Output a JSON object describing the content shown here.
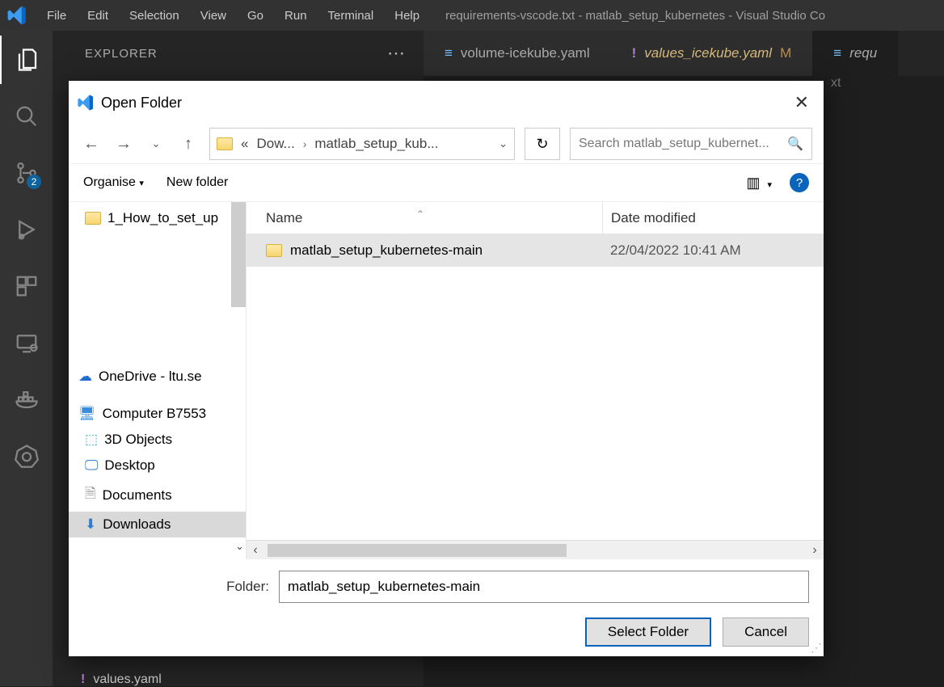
{
  "menubar": {
    "items": [
      "File",
      "Edit",
      "Selection",
      "View",
      "Go",
      "Run",
      "Terminal",
      "Help"
    ],
    "title": "requirements-vscode.txt - matlab_setup_kubernetes - Visual Studio Co"
  },
  "sidebar": {
    "header": "EXPLORER"
  },
  "activity": {
    "badge": "2"
  },
  "tabs": [
    {
      "icon": "lines",
      "label": "volume-icekube.yaml",
      "modified": false
    },
    {
      "icon": "exclaim",
      "label": "values_icekube.yaml",
      "modified": true,
      "modLabel": "M",
      "yellow": true
    },
    {
      "icon": "lines",
      "label": "requ",
      "italic": true
    }
  ],
  "breadcrumb_tail": "xt",
  "below": {
    "item1": "",
    "item2": "values.yaml"
  },
  "dialog": {
    "title": "Open Folder",
    "breadcrumb": {
      "prefix": "«",
      "parent": "Dow...",
      "current": "matlab_setup_kub..."
    },
    "search_placeholder": "Search matlab_setup_kubernet...",
    "organise": "Organise",
    "new_folder": "New folder",
    "columns": {
      "name": "Name",
      "date": "Date modified"
    },
    "nav_items": [
      {
        "label": "1_How_to_set_up",
        "icon": "folder-warn",
        "indent": 1
      },
      {
        "label": "OneDrive - ltu.se",
        "icon": "cloud",
        "section": true
      },
      {
        "label": "Computer B7553",
        "icon": "pc",
        "section": true
      },
      {
        "label": "3D Objects",
        "icon": "cube",
        "indent": 1
      },
      {
        "label": "Desktop",
        "icon": "desktop",
        "indent": 1
      },
      {
        "label": "Documents",
        "icon": "doc",
        "indent": 1
      },
      {
        "label": "Downloads",
        "icon": "download",
        "indent": 1,
        "selected": true
      }
    ],
    "rows": [
      {
        "name": "matlab_setup_kubernetes-main",
        "date": "22/04/2022 10:41 AM"
      }
    ],
    "folder_label": "Folder:",
    "folder_value": "matlab_setup_kubernetes-main",
    "select_btn": "Select Folder",
    "cancel_btn": "Cancel"
  }
}
